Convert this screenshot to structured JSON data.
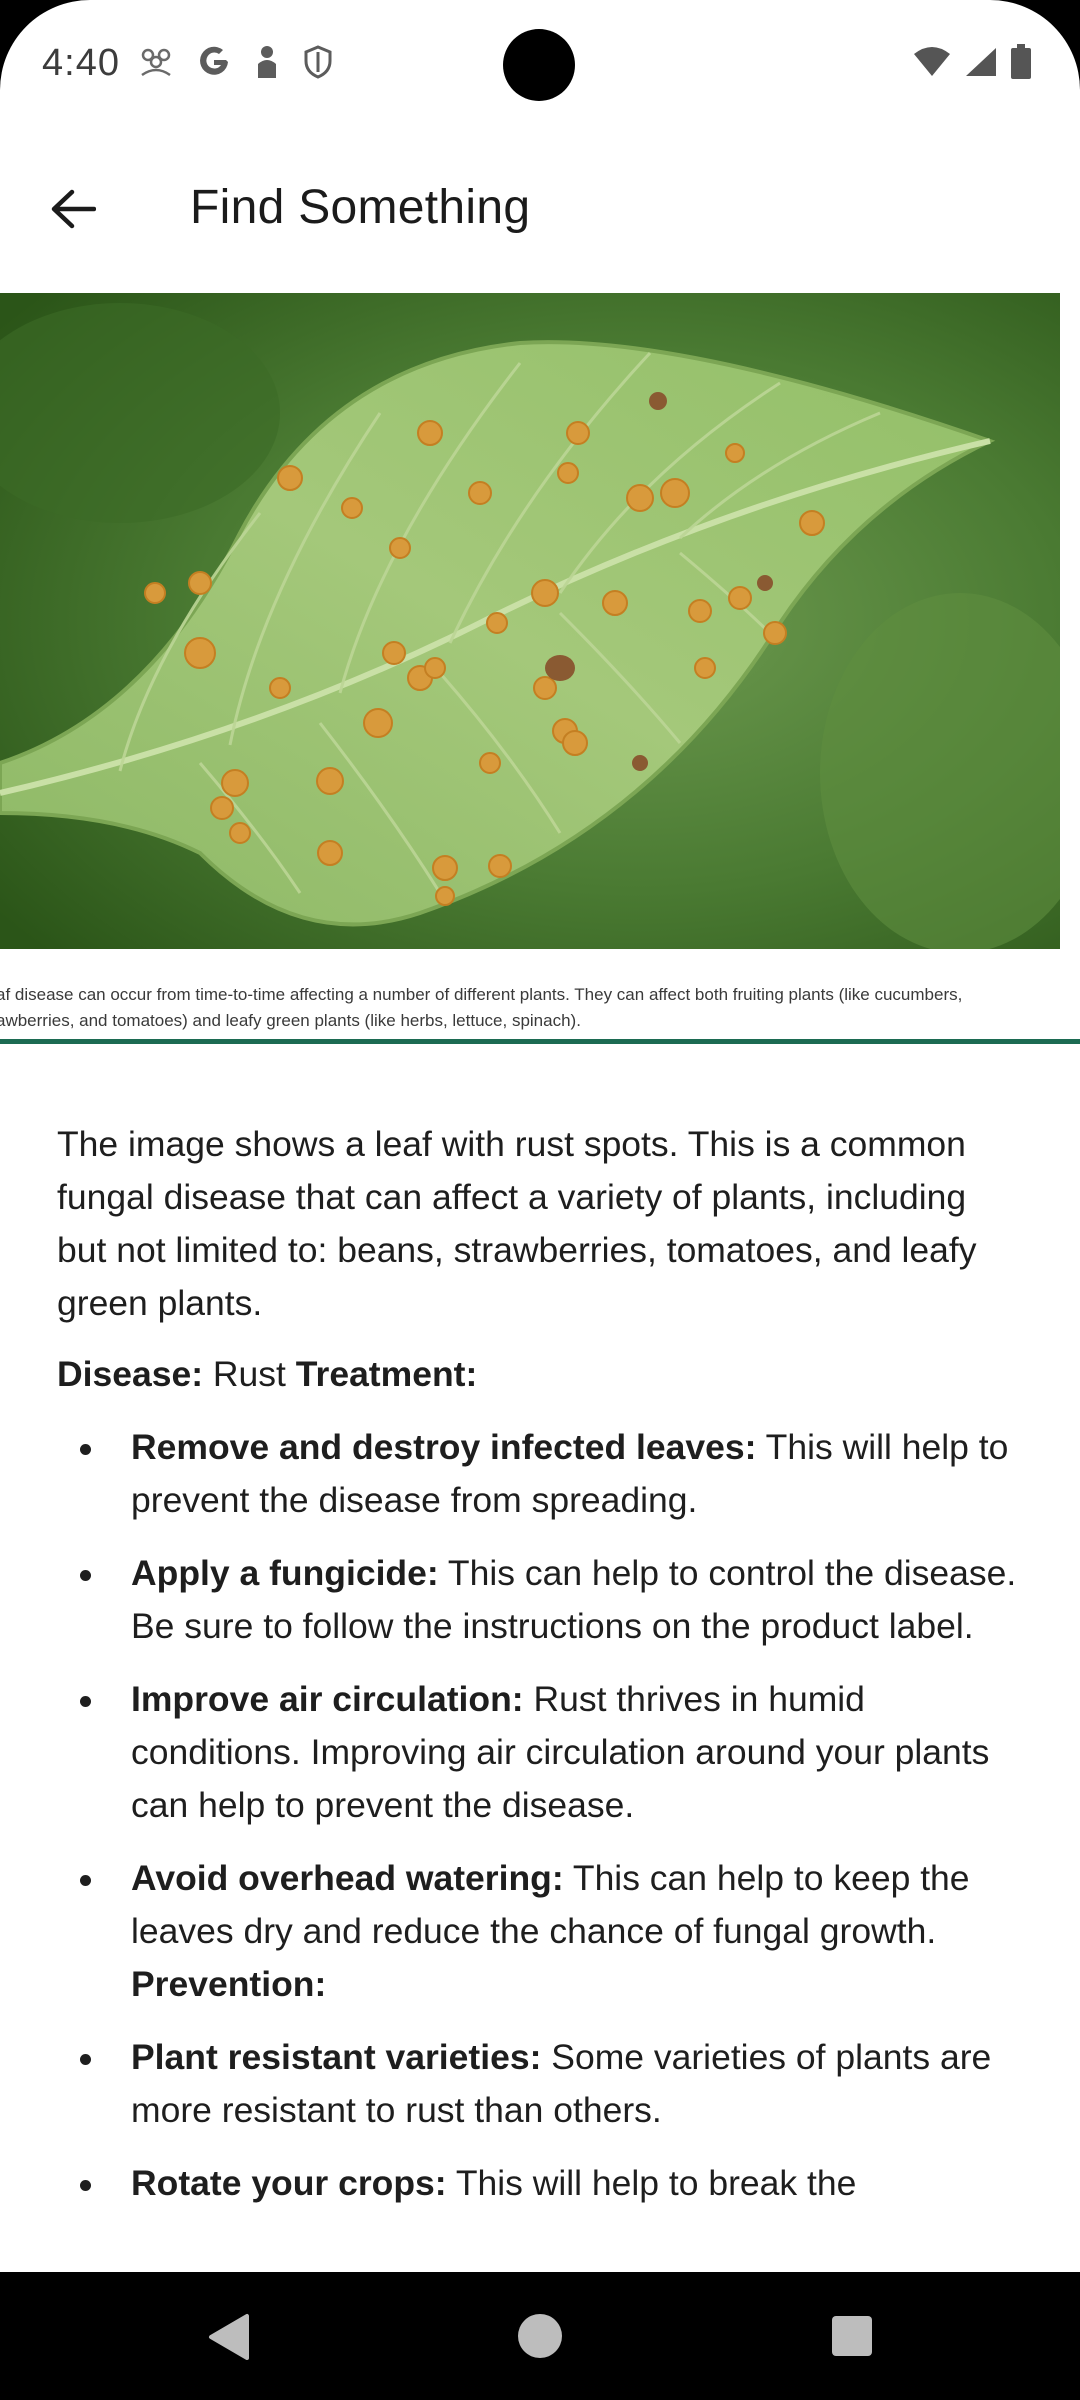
{
  "status_bar": {
    "time": "4:40",
    "left_icons": [
      "community-icon",
      "google-icon",
      "user-shield-icon",
      "shield-icon"
    ],
    "right_icons": [
      "wifi-icon",
      "signal-icon",
      "battery-icon"
    ]
  },
  "app_bar": {
    "back_icon": "arrow-back-icon",
    "title": "Find Something"
  },
  "hero": {
    "image": "leaf-with-rust-spots",
    "caption_line1": "af disease can occur from time-to-time affecting a number of different plants. They can affect both fruiting plants (like cucumbers,",
    "caption_line2": "awberries, and tomatoes) and leafy green plants (like herbs, lettuce, spinach)."
  },
  "article": {
    "intro": "The image shows a leaf with rust spots. This is a common fungal disease that can affect a variety of plants, including but not limited to: beans, strawberries, tomatoes, and leafy green plants.",
    "disease_label": "Disease:",
    "disease_value": " Rust ",
    "treatment_label": "Treatment:",
    "bullets": [
      {
        "bold": "Remove and destroy infected leaves:",
        "text": " This will help to prevent the disease from spreading."
      },
      {
        "bold": "Apply a fungicide:",
        "text": " This can help to control the disease. Be sure to follow the instructions on the product label."
      },
      {
        "bold": "Improve air circulation:",
        "text": " Rust thrives in humid conditions. Improving air circulation around your plants can help to prevent the disease."
      },
      {
        "bold": "Avoid overhead watering:",
        "text": "  This can help to keep the leaves dry and reduce the chance of fungal growth. ",
        "trailing_bold": "Prevention:"
      },
      {
        "bold": "Plant resistant varieties:",
        "text": " Some varieties of plants are more resistant to rust than others."
      },
      {
        "bold": "Rotate your crops:",
        "text": " This will help to break the"
      }
    ]
  },
  "nav_bar": {
    "back": "nav-back-icon",
    "home": "nav-home-icon",
    "recents": "nav-recents-icon"
  },
  "colors": {
    "divider": "#1c6b52",
    "background": "#ffffff",
    "text": "#1e1e1e"
  }
}
